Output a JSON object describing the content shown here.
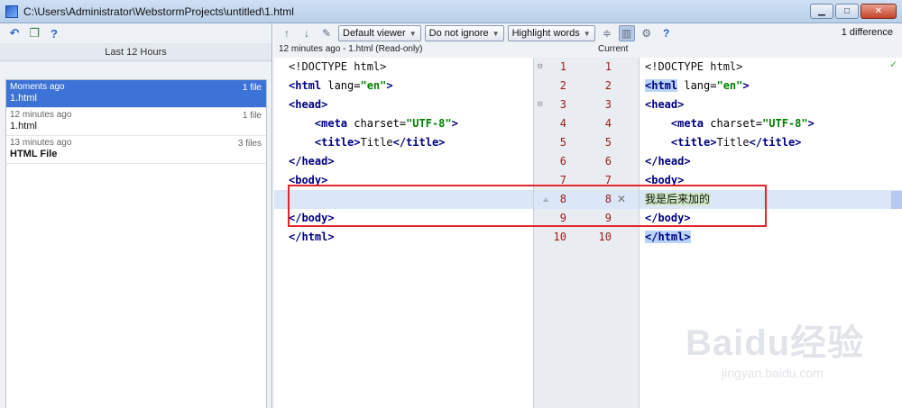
{
  "window": {
    "title": "C:\\Users\\Administrator\\WebstormProjects\\untitled\\1.html"
  },
  "left_panel": {
    "group_header": "Last 12 Hours",
    "revisions": [
      {
        "time": "Moments ago",
        "count": "1 file",
        "name": "1.html"
      },
      {
        "time": "12 minutes ago",
        "count": "1 file",
        "name": "1.html"
      },
      {
        "time": "13 minutes ago",
        "count": "3 files",
        "name": "HTML File"
      }
    ]
  },
  "toolbar": {
    "viewer": "Default viewer",
    "ignore": "Do not ignore",
    "highlight": "Highlight words",
    "diff_count": "1 difference"
  },
  "headers": {
    "left": "12 minutes ago - 1.html (Read-only)",
    "right": "Current"
  },
  "left_code": [
    "<!DOCTYPE html>",
    "<html lang=\"en\">",
    "<head>",
    "    <meta charset=\"UTF-8\">",
    "    <title>Title</title>",
    "</head>",
    "<body>",
    "",
    "</body>",
    "</html>"
  ],
  "right_code": [
    "<!DOCTYPE html>",
    "<html lang=\"en\">",
    "<head>",
    "    <meta charset=\"UTF-8\">",
    "    <title>Title</title>",
    "</head>",
    "<body>",
    "我是后来加的",
    "</body>",
    "</html>"
  ],
  "line_numbers_left": [
    "1",
    "2",
    "3",
    "4",
    "5",
    "6",
    "7",
    "8",
    "9",
    "10"
  ],
  "line_numbers_right": [
    "1",
    "2",
    "3",
    "4",
    "5",
    "6",
    "7",
    "8",
    "9",
    "10"
  ],
  "watermark": {
    "logo": "Baidu经验",
    "url": "jingyan.baidu.com"
  },
  "colors": {
    "selection": "#3d72d6",
    "changed_line": "#dbe6f6",
    "added_text": "#cde8c4",
    "highlight_box": "#e3262b"
  }
}
